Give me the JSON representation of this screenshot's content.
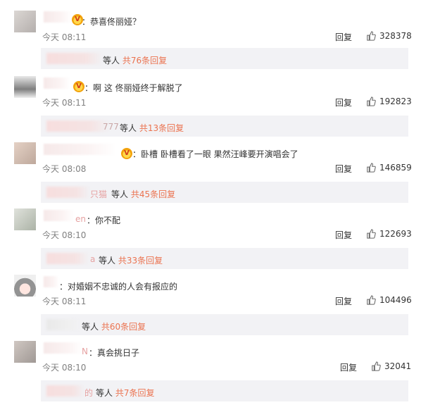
{
  "comments": [
    {
      "text": "：恭喜佟丽娅？",
      "time": "今天 08:11",
      "reply": "回复",
      "likes": "328378",
      "sub_fragment": "",
      "sub_who": "等人",
      "sub_count": "共76条回复"
    },
    {
      "text": "：啊 这  佟丽娅终于解脱了",
      "time": "今天 08:11",
      "reply": "回复",
      "likes": "192823",
      "sub_fragment": "777",
      "sub_who": "等人",
      "sub_count": "共13条回复"
    },
    {
      "text": "：卧槽 卧槽看了一眼 果然汪峰要开演唱会了",
      "time": "今天 08:08",
      "reply": "回复",
      "likes": "146859",
      "sub_fragment": "只猫",
      "sub_who": "等人",
      "sub_count": "共45条回复"
    },
    {
      "text": "：你不配",
      "time": "今天 08:10",
      "reply": "回复",
      "likes": "122693",
      "sub_fragment": "a",
      "sub_who": "等人",
      "sub_count": "共33条回复",
      "name_fragment": "en"
    },
    {
      "text": "：对婚姻不忠诚的人会有报应的",
      "time": "今天 08:11",
      "reply": "回复",
      "likes": "104496",
      "sub_fragment": "",
      "sub_who": "等人",
      "sub_count": "共60条回复"
    },
    {
      "text": "：真会挑日子",
      "time": "今天 08:10",
      "reply": "回复",
      "likes": "32041",
      "sub_fragment": "的",
      "sub_who": "等人",
      "sub_count": "共7条回复",
      "name_fragment": "N"
    }
  ],
  "colors": {
    "link": "#eb7350",
    "muted": "#808080",
    "subbar": "#f2f2f5"
  },
  "icons": {
    "badge": "vip-crown-icon",
    "like": "thumbs-up-icon"
  }
}
